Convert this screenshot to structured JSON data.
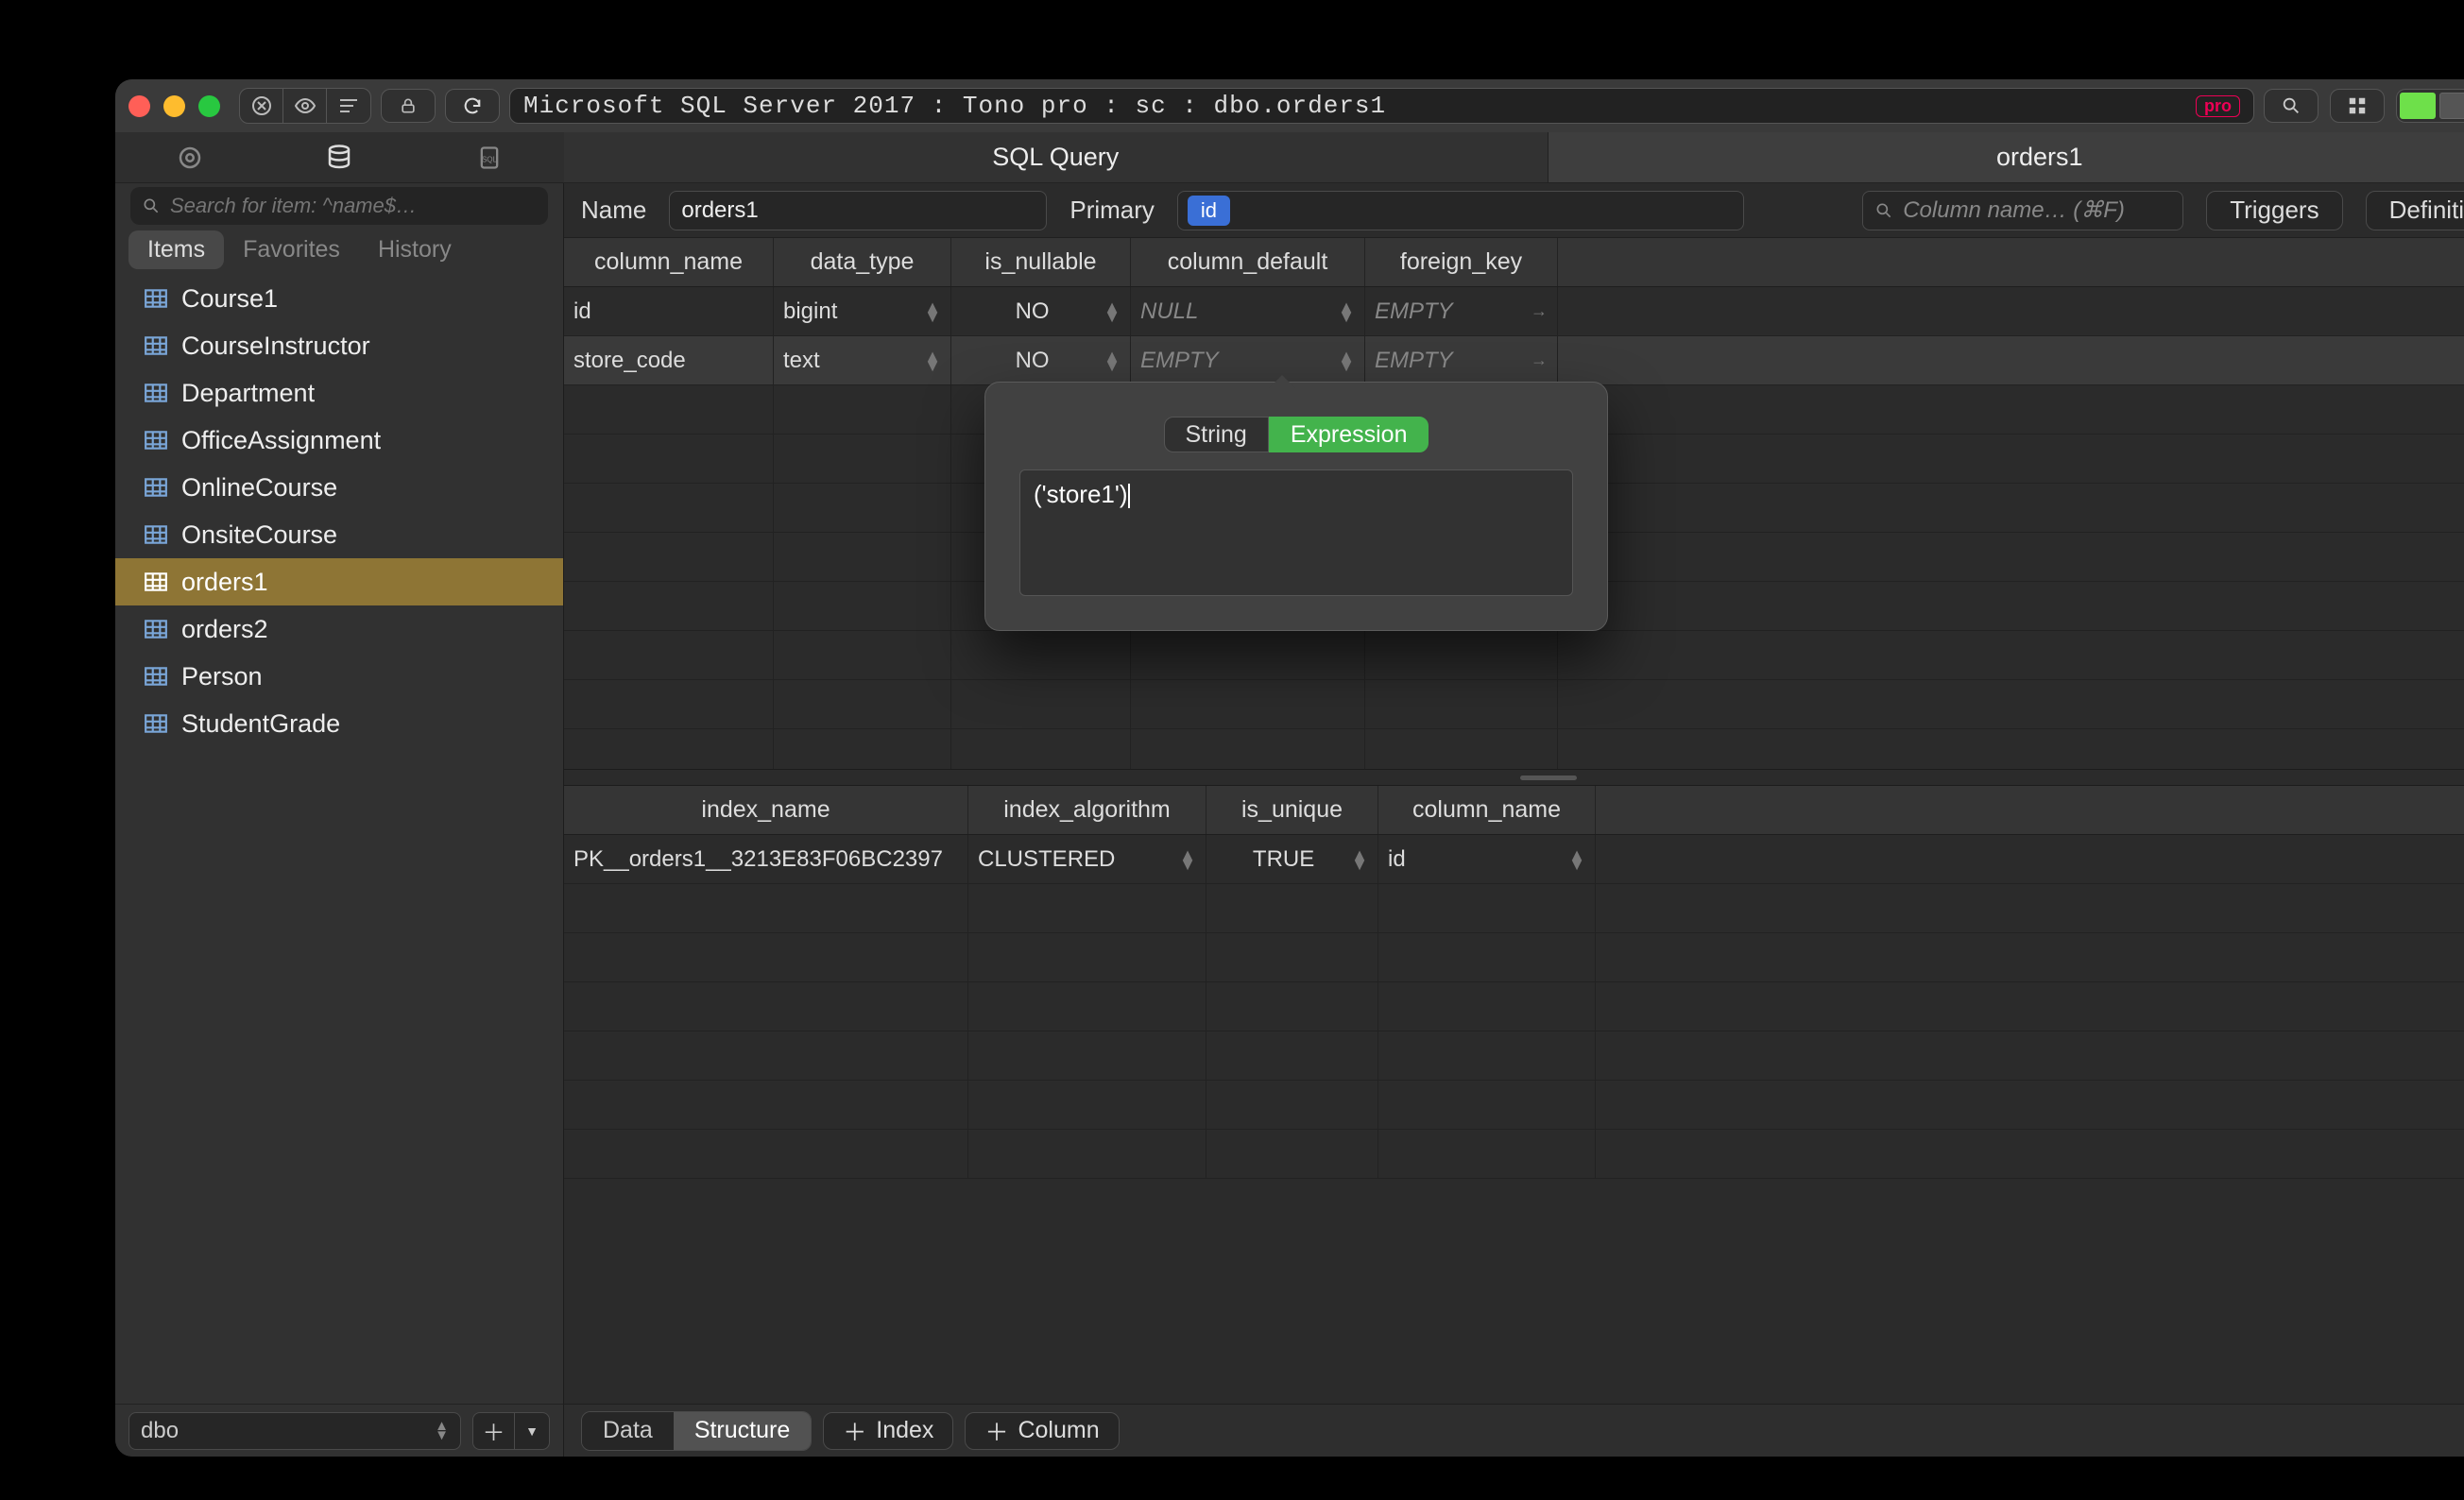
{
  "titlebar": {
    "path": "Microsoft SQL Server 2017 : Tono pro : sc : dbo.orders1",
    "pro_badge": "pro"
  },
  "main_tabs": [
    "SQL Query",
    "orders1"
  ],
  "sidebar": {
    "search_placeholder": "Search for item: ^name$…",
    "tabs": [
      "Items",
      "Favorites",
      "History"
    ],
    "items": [
      {
        "label": "Course1"
      },
      {
        "label": "CourseInstructor"
      },
      {
        "label": "Department"
      },
      {
        "label": "OfficeAssignment"
      },
      {
        "label": "OnlineCourse"
      },
      {
        "label": "OnsiteCourse"
      },
      {
        "label": "orders1"
      },
      {
        "label": "orders2"
      },
      {
        "label": "Person"
      },
      {
        "label": "StudentGrade"
      }
    ],
    "schema": "dbo"
  },
  "name_row": {
    "name_label": "Name",
    "name_value": "orders1",
    "primary_label": "Primary",
    "primary_token": "id",
    "col_search_placeholder": "Column name… (⌘F)",
    "triggers_btn": "Triggers",
    "definition_btn": "Definition"
  },
  "columns": {
    "headers": [
      "column_name",
      "data_type",
      "is_nullable",
      "column_default",
      "foreign_key"
    ],
    "rows": [
      {
        "name": "id",
        "type": "bigint",
        "nullable": "NO",
        "default": "NULL",
        "default_dim": true,
        "fk": "EMPTY",
        "fk_dim": true
      },
      {
        "name": "store_code",
        "type": "text",
        "nullable": "NO",
        "default": "EMPTY",
        "default_dim": true,
        "fk": "EMPTY",
        "fk_dim": true
      }
    ]
  },
  "popover": {
    "tab_string": "String",
    "tab_expression": "Expression",
    "value": "('store1')"
  },
  "indexes": {
    "headers": [
      "index_name",
      "index_algorithm",
      "is_unique",
      "column_name"
    ],
    "rows": [
      {
        "name": "PK__orders1__3213E83F06BC2397",
        "algo": "CLUSTERED",
        "unique": "TRUE",
        "col": "id"
      }
    ]
  },
  "bottom": {
    "seg_data": "Data",
    "seg_structure": "Structure",
    "add_index": "Index",
    "add_column": "Column"
  }
}
